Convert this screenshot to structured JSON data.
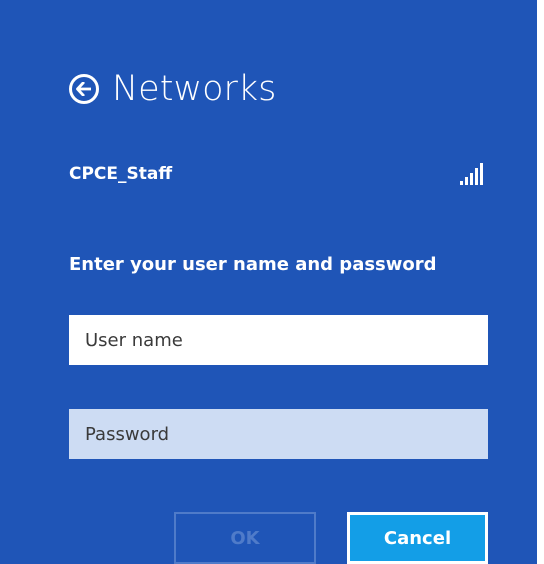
{
  "colors": {
    "panel_background": "#1f55b7",
    "password_field_background": "#cddcf3",
    "ok_button_text": "#4f7bc9",
    "cancel_button_background": "#139ee7"
  },
  "header": {
    "title": "Networks",
    "back_icon": "arrow-left-circle-icon"
  },
  "network": {
    "name": "CPCE_Staff",
    "signal_icon": "wifi-signal-bars-icon"
  },
  "form": {
    "prompt": "Enter your user name and password",
    "username_placeholder": "User name",
    "password_placeholder": "Password"
  },
  "buttons": {
    "ok_label": "OK",
    "cancel_label": "Cancel"
  }
}
